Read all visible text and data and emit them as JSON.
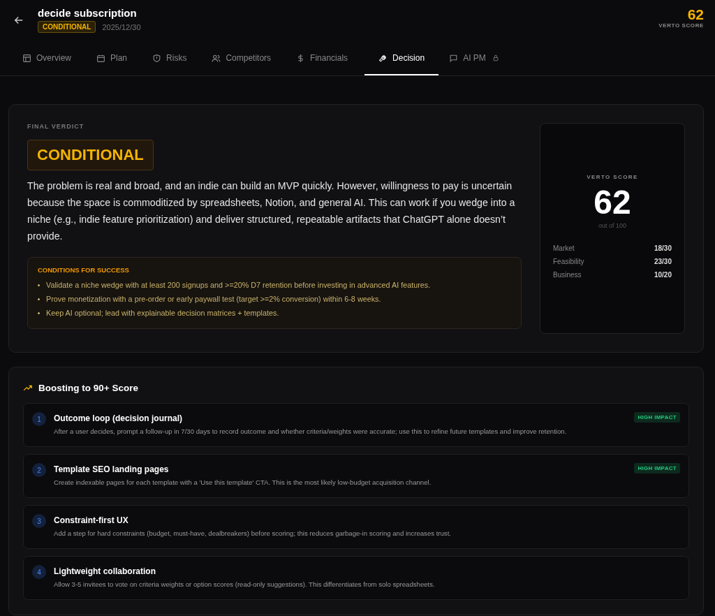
{
  "header": {
    "title": "decide subscription",
    "status": "CONDITIONAL",
    "date": "2025/12/30",
    "score": "62",
    "score_label": "VERTO SCORE"
  },
  "tabs": [
    {
      "label": "Overview",
      "selected": false,
      "locked": false
    },
    {
      "label": "Plan",
      "selected": false,
      "locked": false
    },
    {
      "label": "Risks",
      "selected": false,
      "locked": false
    },
    {
      "label": "Competitors",
      "selected": false,
      "locked": false
    },
    {
      "label": "Financials",
      "selected": false,
      "locked": false
    },
    {
      "label": "Decision",
      "selected": true,
      "locked": false
    },
    {
      "label": "AI PM",
      "selected": false,
      "locked": true
    }
  ],
  "verdict": {
    "eyebrow": "FINAL VERDICT",
    "label": "CONDITIONAL",
    "summary": "The problem is real and broad, and an indie can build an MVP quickly. However, willingness to pay is uncertain because the space is commoditized by spreadsheets, Notion, and general AI. This can work if you wedge into a niche (e.g., indie feature prioritization) and deliver structured, repeatable artifacts that ChatGPT alone doesn’t provide.",
    "conditions_title": "CONDITIONS FOR SUCCESS",
    "conditions": [
      "Validate a niche wedge with at least 200 signups and >=20% D7 retention before investing in advanced AI features.",
      "Prove monetization with a pre-order or early paywall test (target >=2% conversion) within 6-8 weeks.",
      "Keep AI optional; lead with explainable decision matrices + templates."
    ]
  },
  "score_card": {
    "label": "VERTO SCORE",
    "score": "62",
    "out_of": "out of 100",
    "breakdown": [
      {
        "name": "Market",
        "value": "18/30"
      },
      {
        "name": "Feasibility",
        "value": "23/30"
      },
      {
        "name": "Business",
        "value": "10/20"
      }
    ]
  },
  "boosts": {
    "title": "Boosting to 90+ Score",
    "items": [
      {
        "number": "1",
        "title": "Outcome loop (decision journal)",
        "description": "After a user decides, prompt a follow-up in 7/30 days to record outcome and whether criteria/weights were accurate; use this to refine future templates and improve retention.",
        "impact": "HIGH IMPACT"
      },
      {
        "number": "2",
        "title": "Template SEO landing pages",
        "description": "Create indexable pages for each template with a 'Use this template' CTA. This is the most likely low-budget acquisition channel.",
        "impact": "HIGH IMPACT"
      },
      {
        "number": "3",
        "title": "Constraint-first UX",
        "description": "Add a step for hard constraints (budget, must-have, dealbreakers) before scoring; this reduces garbage-in scoring and increases trust."
      },
      {
        "number": "4",
        "title": "Lightweight collaboration",
        "description": "Allow 3-5 invitees to vote on criteria weights or option scores (read-only suggestions). This differentiates from solo spreadsheets."
      }
    ]
  }
}
